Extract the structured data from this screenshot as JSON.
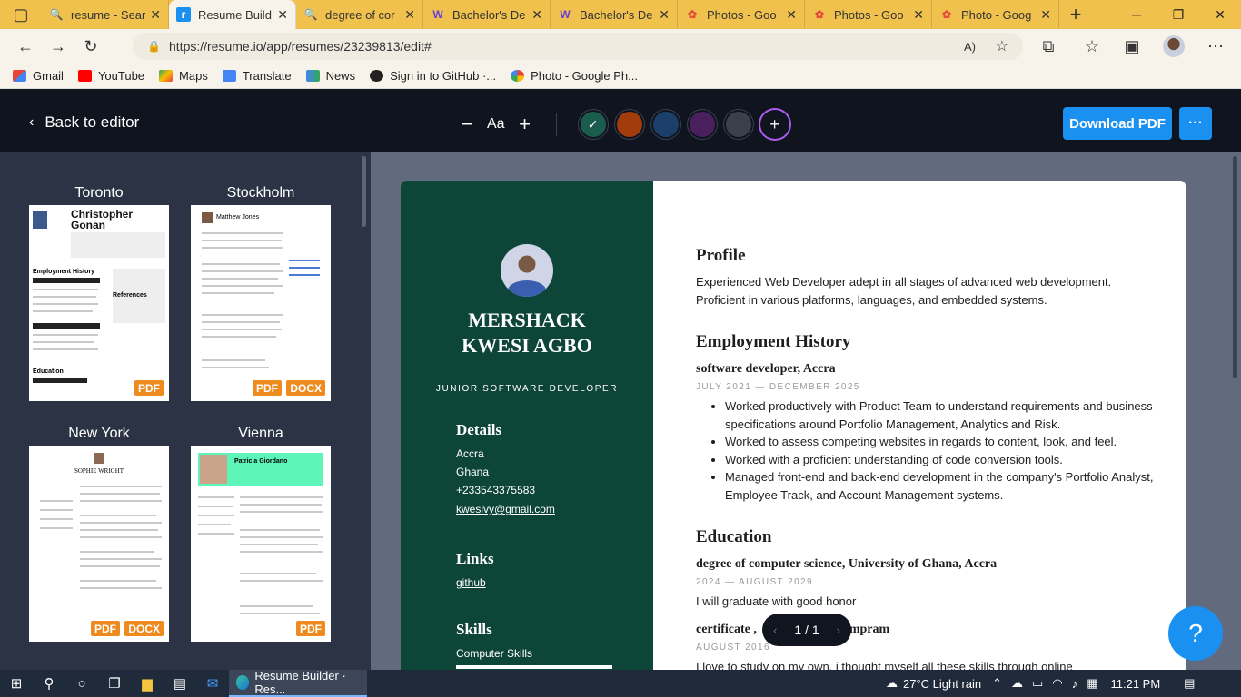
{
  "browser": {
    "tabs": [
      {
        "label": "resume - Sear",
        "icon": "search-icon"
      },
      {
        "label": "Resume Build",
        "icon": "resume-io-icon"
      },
      {
        "label": "degree of cor",
        "icon": "search-icon"
      },
      {
        "label": "Bachelor's De",
        "icon": "w-icon"
      },
      {
        "label": "Bachelor's De",
        "icon": "w-icon"
      },
      {
        "label": "Photos - Goo",
        "icon": "google-photos-icon"
      },
      {
        "label": "Photos - Goo",
        "icon": "google-photos-icon"
      },
      {
        "label": "Photo - Goog",
        "icon": "google-photos-icon"
      }
    ],
    "url": "https://resume.io/app/resumes/23239813/edit#",
    "bookmarks": [
      "Gmail",
      "YouTube",
      "Maps",
      "Translate",
      "News",
      "Sign in to GitHub ·...",
      "Photo - Google Ph..."
    ]
  },
  "header": {
    "back_label": "Back to editor",
    "font_size_label": "Aa",
    "download_label": "Download PDF",
    "colors": [
      "#1a5c4e",
      "#a33c0c",
      "#1b3f68",
      "#4a1f5e",
      "#3a3f4b"
    ]
  },
  "templates": [
    {
      "name": "Toronto",
      "badges": [
        "PDF"
      ]
    },
    {
      "name": "Stockholm",
      "badges": [
        "PDF",
        "DOCX"
      ]
    },
    {
      "name": "New York",
      "badges": [
        "PDF",
        "DOCX"
      ]
    },
    {
      "name": "Vienna",
      "badges": [
        "PDF"
      ]
    }
  ],
  "resume": {
    "name_line1": "MERSHACK",
    "name_line2": "KWESI AGBO",
    "job_title": "JUNIOR SOFTWARE DEVELOPER",
    "details_heading": "Details",
    "details": [
      "Accra",
      "Ghana",
      "+233543375583",
      "kwesivy@gmail.com"
    ],
    "links_heading": "Links",
    "link": "github",
    "skills_heading": "Skills",
    "skill": "Computer Skills",
    "profile_heading": "Profile",
    "profile_text": "Experienced Web Developer adept in all stages of advanced web development. Proficient in various platforms, languages, and embedded systems.",
    "employment_heading": "Employment History",
    "job1_title": "software developer, Accra",
    "job1_dates": "JULY 2021 — DECEMBER 2025",
    "job1_bullets": [
      "Worked productively with Product Team to understand requirements and business specifications around Portfolio Management, Analytics and Risk.",
      "Worked to assess competing websites in regards to content, look, and feel.",
      "Worked with a proficient understanding of code conversion tools.",
      "Managed front-end and back-end development in the company's Portfolio Analyst, Employee Track, and Account Management systems."
    ],
    "education_heading": "Education",
    "edu1_title": "degree of computer science, University of Ghana, Accra",
    "edu1_dates": "2024 — AUGUST 2029",
    "edu1_text": "I will graduate with good honor",
    "edu2_title_start": "certificate ,",
    "edu2_title_end": "mpram",
    "edu2_dates": "AUGUST 2016",
    "edu2_text": "I love to study on my own, i thought myself all these skills through online"
  },
  "pager": {
    "label": "1 / 1"
  },
  "help": {
    "label": "?"
  },
  "taskbar": {
    "app_label": "Resume Builder · Res...",
    "weather": "27°C  Light rain",
    "time": "11:21 PM"
  }
}
